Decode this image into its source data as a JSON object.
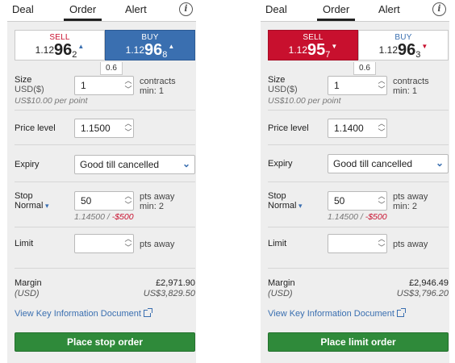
{
  "panels": [
    {
      "tabs": {
        "deal": "Deal",
        "order": "Order",
        "alert": "Alert",
        "info": "i"
      },
      "sell": {
        "label": "SELL",
        "price_small": "1.12",
        "price_big": "96",
        "price_sub": "2",
        "arrow": "▲"
      },
      "buy": {
        "label": "BUY",
        "price_small": "1.12",
        "price_big": "96",
        "price_sub": "8",
        "arrow": "▲"
      },
      "spread": "0.6",
      "size": {
        "label": "Size",
        "currency": "USD($)",
        "value": "1",
        "unit1": "contracts",
        "unit2": "min: 1",
        "hint": "US$10.00 per point"
      },
      "price_level": {
        "label": "Price level",
        "value": "1.1500"
      },
      "expiry": {
        "label": "Expiry",
        "value": "Good till cancelled"
      },
      "stop": {
        "label": "Stop",
        "type": "Normal",
        "value": "50",
        "unit1": "pts away",
        "unit2": "min: 2",
        "hint_level": "1.14500 / ",
        "hint_amount": "-$500"
      },
      "limit": {
        "label": "Limit",
        "value": "",
        "unit": "pts away"
      },
      "margin": {
        "label": "Margin",
        "currency": "(USD)",
        "gbp": "£2,971.90",
        "usd": "US$3,829.50"
      },
      "kid_link": "View Key Information Document",
      "submit": "Place stop order"
    },
    {
      "tabs": {
        "deal": "Deal",
        "order": "Order",
        "alert": "Alert",
        "info": "i"
      },
      "sell": {
        "label": "SELL",
        "price_small": "1.12",
        "price_big": "95",
        "price_sub": "7",
        "arrow": "▼"
      },
      "buy": {
        "label": "BUY",
        "price_small": "1.12",
        "price_big": "96",
        "price_sub": "3",
        "arrow": "▼"
      },
      "spread": "0.6",
      "size": {
        "label": "Size",
        "currency": "USD($)",
        "value": "1",
        "unit1": "contracts",
        "unit2": "min: 1",
        "hint": "US$10.00 per point"
      },
      "price_level": {
        "label": "Price level",
        "value": "1.1400"
      },
      "expiry": {
        "label": "Expiry",
        "value": "Good till cancelled"
      },
      "stop": {
        "label": "Stop",
        "type": "Normal",
        "value": "50",
        "unit1": "pts away",
        "unit2": "min: 2",
        "hint_level": "1.14500 / ",
        "hint_amount": "-$500"
      },
      "limit": {
        "label": "Limit",
        "value": "",
        "unit": "pts away"
      },
      "margin": {
        "label": "Margin",
        "currency": "(USD)",
        "gbp": "£2,946.49",
        "usd": "US$3,796.20"
      },
      "kid_link": "View Key Information Document",
      "submit": "Place limit order"
    }
  ],
  "colors": {
    "sell_red": "#c8102e",
    "buy_blue": "#3a6fb0",
    "submit_green": "#2f8a3a",
    "panel_bg": "#eeeeee"
  },
  "icons": {
    "info": "info-icon",
    "spin_up": "chevron-up-icon",
    "spin_down": "chevron-down-icon",
    "select": "chevron-down-icon",
    "external": "external-link-icon",
    "price_up": "arrow-up-icon",
    "price_down": "arrow-down-icon"
  }
}
